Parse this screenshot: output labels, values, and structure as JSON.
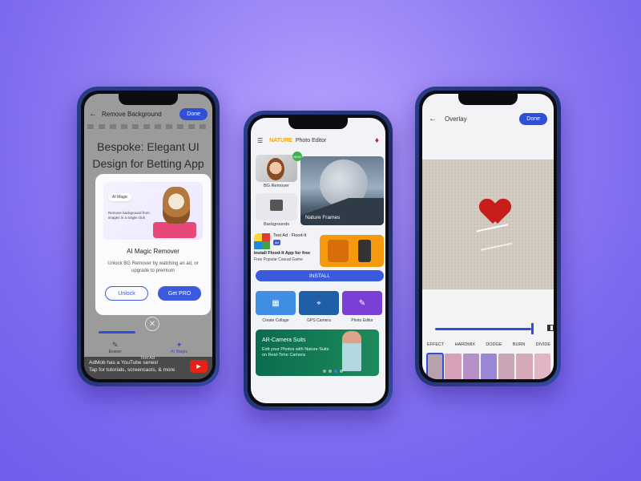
{
  "phone1": {
    "title": "Remove Background",
    "done": "Done",
    "heading_line1": "Bespoke: Elegant UI",
    "heading_line2": "Design for Betting App",
    "modal": {
      "chip": "AI Magic",
      "art_text": "Remove background from images in a single click",
      "title": "AI Magic Remover",
      "desc": "Unlock BG Remover by watching an ad, or upgrade to premium",
      "unlock": "Unlock",
      "get_pro": "Get PRO"
    },
    "nav": [
      {
        "label": "Eraser",
        "icon": "✎"
      },
      {
        "label": "AI Magic",
        "icon": "✦"
      }
    ],
    "ad": {
      "test": "Test Ad",
      "line1": "AdMob has a YouTube series!",
      "line2": "Tap for tutorials, screencasts, & more",
      "yt": "▶"
    }
  },
  "phone2": {
    "brand": "NATURE",
    "subtitle": "Photo Editor",
    "bg_remover": "BG Remover",
    "new_badge": "NEW",
    "backgrounds": "Backgrounds",
    "nature_frames": "Nature Frames",
    "ad": {
      "title": "Test Ad : Flood-It",
      "tag": "Ad",
      "line1": "Install Flood-It App for free",
      "line2": "Free Popular Casual Game"
    },
    "install": "INSTALL",
    "tiles": [
      {
        "label": "Create Collage",
        "color": "#3f8ee3",
        "icon": "▦"
      },
      {
        "label": "GPS Camera",
        "color": "#1f5fa8",
        "icon": "⌖"
      },
      {
        "label": "Photo Editor",
        "color": "#7b3fd6",
        "icon": "✎"
      }
    ],
    "banner": {
      "title": "AR-Camera Suits",
      "subtitle": "Edit your Photos with Nature Suits on Real-Time Camera"
    }
  },
  "phone3": {
    "title": "Overlay",
    "done": "Done",
    "blend_modes": [
      "EFFECT",
      "HARDMIX",
      "DODGE",
      "BURN",
      "DIVIDE"
    ],
    "thumb_colors": [
      "#b7a1ad",
      "#d7a1b9",
      "#b890c8",
      "#9a86d6",
      "#c9a4b6",
      "#d6a9b8",
      "#e1b4c4"
    ]
  },
  "colors": {
    "accent": "#2f4fd8",
    "brand": "#f5a300"
  }
}
